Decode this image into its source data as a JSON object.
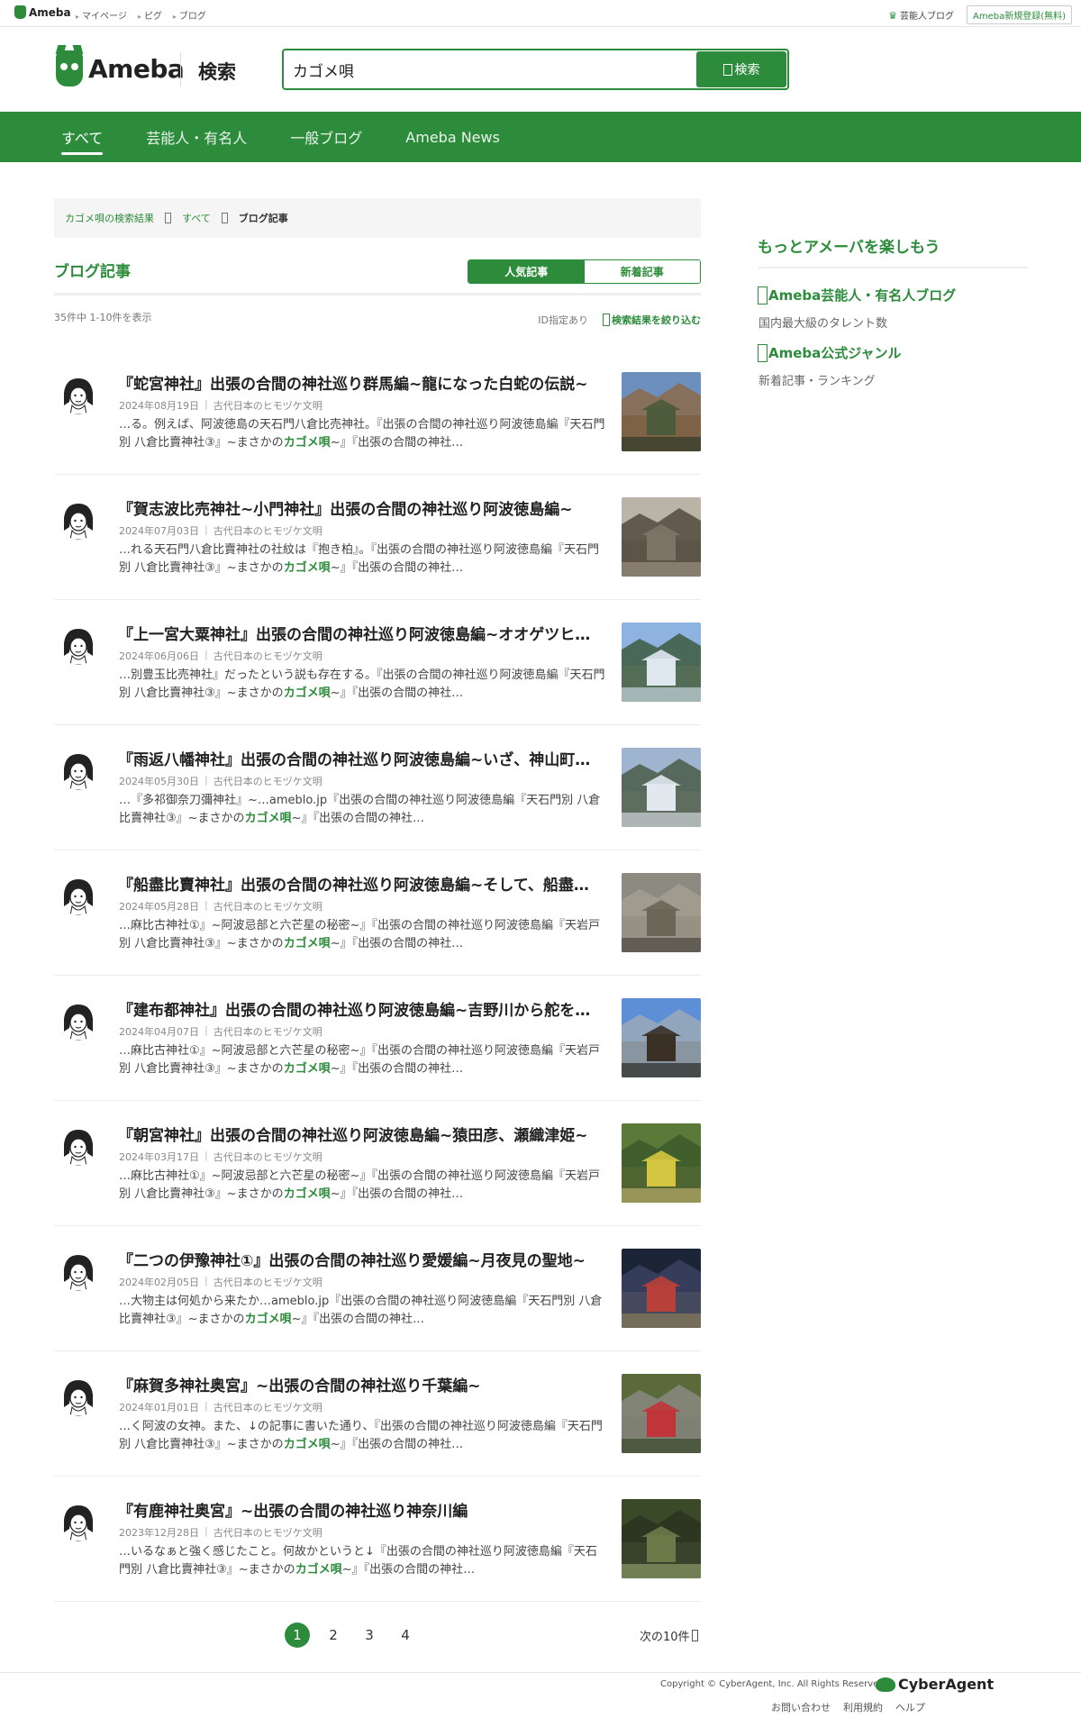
{
  "topbar": {
    "logo": "Ameba",
    "links": [
      "マイページ",
      "ピグ",
      "ブログ"
    ],
    "talent_blog": "芸能人ブログ",
    "register": "Ameba新規登録(無料)"
  },
  "header": {
    "brand": "Ameba",
    "search_label": "検索",
    "search_value": "カゴメ唄",
    "search_button": "検索"
  },
  "nav": {
    "tabs": [
      {
        "label": "すべて",
        "active": true
      },
      {
        "label": "芸能人・有名人",
        "active": false
      },
      {
        "label": "一般ブログ",
        "active": false
      },
      {
        "label": "Ameba News",
        "active": false
      }
    ]
  },
  "breadcrumb": {
    "items": [
      "カゴメ唄の検索結果",
      "すべて"
    ],
    "current": "ブログ記事"
  },
  "section": {
    "title": "ブログ記事",
    "sort_popular": "人気記事",
    "sort_new": "新着記事",
    "count": "35件中 1-10件を表示",
    "id_spec": "ID指定あり",
    "refine": "検索結果を絞り込む"
  },
  "results": [
    {
      "title": "『蛇宮神社』出張の合間の神社巡り群馬編~龍になった白蛇の伝説~",
      "date": "2024年08月19日",
      "blog": "古代日本のヒモヅケ文明",
      "pre": "…る。例えば、阿波徳島の天石門八倉比売神社。『出張の合間の神社巡り阿波徳島編『天石門別 八倉比賣神社③』~まさかの",
      "kw": "カゴメ唄",
      "post": "~』『出張の合間の神社…",
      "thumb": "temple-snow"
    },
    {
      "title": "『賀志波比売神社~小門神社』出張の合間の神社巡り阿波徳島編~",
      "date": "2024年07月03日",
      "blog": "古代日本のヒモヅケ文明",
      "pre": "…れる天石門八倉比賣神社の社紋は『抱き柏』。『出張の合間の神社巡り阿波徳島編『天石門別 八倉比賣神社③』~まさかの",
      "kw": "カゴメ唄",
      "post": "~』『出張の合間の神社…",
      "thumb": "stone"
    },
    {
      "title": "『上一宮大粟神社』出張の合間の神社巡り阿波徳島編~オオゲツヒメ~",
      "date": "2024年06月06日",
      "blog": "古代日本のヒモヅケ文明",
      "pre": "…別豊玉比売神社』だったという説も存在する。『出張の合間の神社巡り阿波徳島編『天石門別 八倉比賣神社③』~まさかの",
      "kw": "カゴメ唄",
      "post": "~』『出張の合間の神社…",
      "thumb": "snow-torii"
    },
    {
      "title": "『雨返八幡神社』出張の合間の神社巡り阿波徳島編~いざ、神山町へ~",
      "date": "2024年05月30日",
      "blog": "古代日本のヒモヅケ文明",
      "pre": "…『多祁御奈刀彌神社』~…ameblo.jp『出張の合間の神社巡り阿波徳島編『天石門別 八倉比賣神社③』~まさかの",
      "kw": "カゴメ唄",
      "post": "~』『出張の合間の神社…",
      "thumb": "snow-stairs"
    },
    {
      "title": "『船盡比賣神社』出張の合間の神社巡り阿波徳島編~そして、船盡へ~",
      "date": "2024年05月28日",
      "blog": "古代日本のヒモヅケ文明",
      "pre": "…麻比古神社①』~阿波忌部と六芒星の秘密~』『出張の合間の神社巡り阿波徳島編『天岩戸別 八倉比賣神社③』~まさかの",
      "kw": "カゴメ唄",
      "post": "~』『出張の合間の神社…",
      "thumb": "rock"
    },
    {
      "title": "『建布都神社』出張の合間の神社巡り阿波徳島編~吉野川から舵をとる~",
      "date": "2024年04月07日",
      "blog": "古代日本のヒモヅケ文明",
      "pre": "…麻比古神社①』~阿波忌部と六芒星の秘密~』『出張の合間の神社巡り阿波徳島編『天岩戸別 八倉比賣神社③』~まさかの",
      "kw": "カゴメ唄",
      "post": "~』『出張の合間の神社…",
      "thumb": "shrine-blue"
    },
    {
      "title": "『朝宮神社』出張の合間の神社巡り阿波徳島編~猿田彦、瀬織津姫~",
      "date": "2024年03月17日",
      "blog": "古代日本のヒモヅケ文明",
      "pre": "…麻比古神社①』~阿波忌部と六芒星の秘密~』『出張の合間の神社巡り阿波徳島編『天岩戸別 八倉比賣神社③』~まさかの",
      "kw": "カゴメ唄",
      "post": "~』『出張の合間の神社…",
      "thumb": "field"
    },
    {
      "title": "『二つの伊豫神社①』出張の合間の神社巡り愛媛編~月夜見の聖地~",
      "date": "2024年02月05日",
      "blog": "古代日本のヒモヅケ文明",
      "pre": "…大物主は何処から来たか…ameblo.jp『出張の合間の神社巡り阿波徳島編『天石門別 八倉比賣神社③』~まさかの",
      "kw": "カゴメ唄",
      "post": "~』『出張の合間の神社…",
      "thumb": "red-torii"
    },
    {
      "title": "『麻賀多神社奥宮』~出張の合間の神社巡り千葉編~",
      "date": "2024年01月01日",
      "blog": "古代日本のヒモヅケ文明",
      "pre": "…く阿波の女神。また、↓の記事に書いた通り、『出張の合間の神社巡り阿波徳島編『天石門別 八倉比賣神社③』~まさかの",
      "kw": "カゴメ唄",
      "post": "~』『出張の合間の神社…",
      "thumb": "red-shrine"
    },
    {
      "title": "『有鹿神社奥宮』~出張の合間の神社巡り神奈川編",
      "date": "2023年12月28日",
      "blog": "古代日本のヒモヅケ文明",
      "pre": "…いるなぁと強く感じたこと。何故かというと↓『出張の合間の神社巡り阿波徳島編『天石門別 八倉比賣神社③』~まさかの",
      "kw": "カゴメ唄",
      "post": "~』『出張の合間の神社…",
      "thumb": "forest-torii"
    }
  ],
  "pagination": {
    "pages": [
      "1",
      "2",
      "3",
      "4"
    ],
    "current": "1",
    "next": "次の10件"
  },
  "sidebar": {
    "title": "もっとアメーバを楽しもう",
    "links": [
      {
        "label": "Ameba芸能人・有名人ブログ",
        "desc": "国内最大級のタレント数"
      },
      {
        "label": "Ameba公式ジャンル",
        "desc": "新着記事・ランキング"
      }
    ]
  },
  "footer": {
    "copyright": "Copyright © CyberAgent, Inc. All Rights Reserved.",
    "company": "CyberAgent",
    "links": [
      "お問い合わせ",
      "利用規約",
      "ヘルプ"
    ]
  },
  "colors": {
    "accent": "#2d8c3c",
    "nav_bg": "#2d8c3c"
  }
}
